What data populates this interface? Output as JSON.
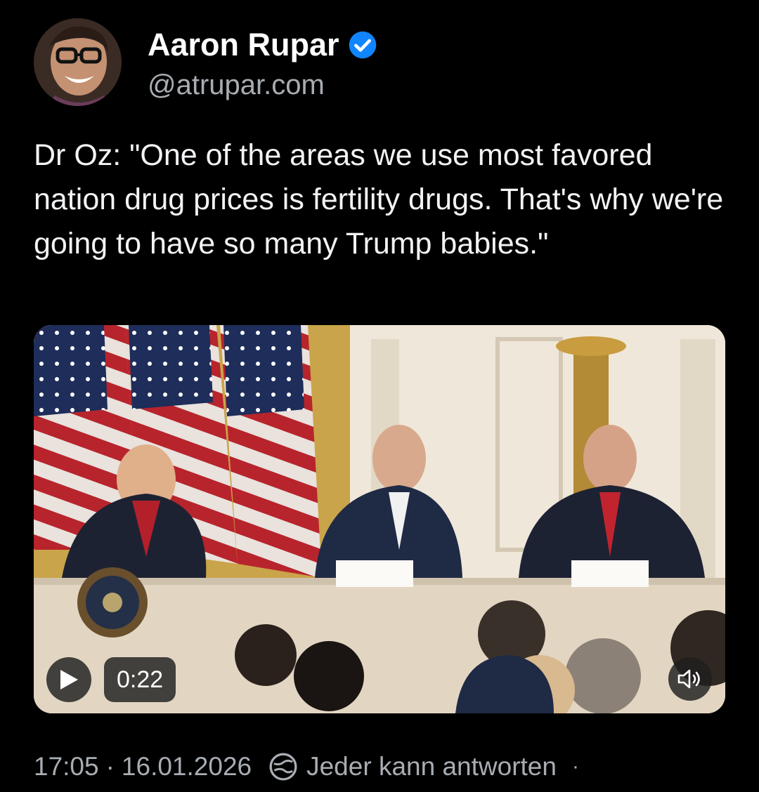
{
  "author": {
    "display_name": "Aaron Rupar",
    "handle": "@atrupar.com",
    "verified": true,
    "verified_color": "#1185fe"
  },
  "post": {
    "text": "Dr Oz: \"One of the areas we use most favored nation drug prices is fertility drugs. That's why we're going to have so many Trump babies.\""
  },
  "video": {
    "duration": "0:22",
    "play_icon": "play-icon",
    "mute_icon": "speaker-icon"
  },
  "meta": {
    "time": "17:05",
    "separator": "·",
    "date": "16.01.2026",
    "reply_setting": "Jeder kann antworten",
    "trailing_separator": "·",
    "reply_icon": "everyone-reply-icon"
  }
}
